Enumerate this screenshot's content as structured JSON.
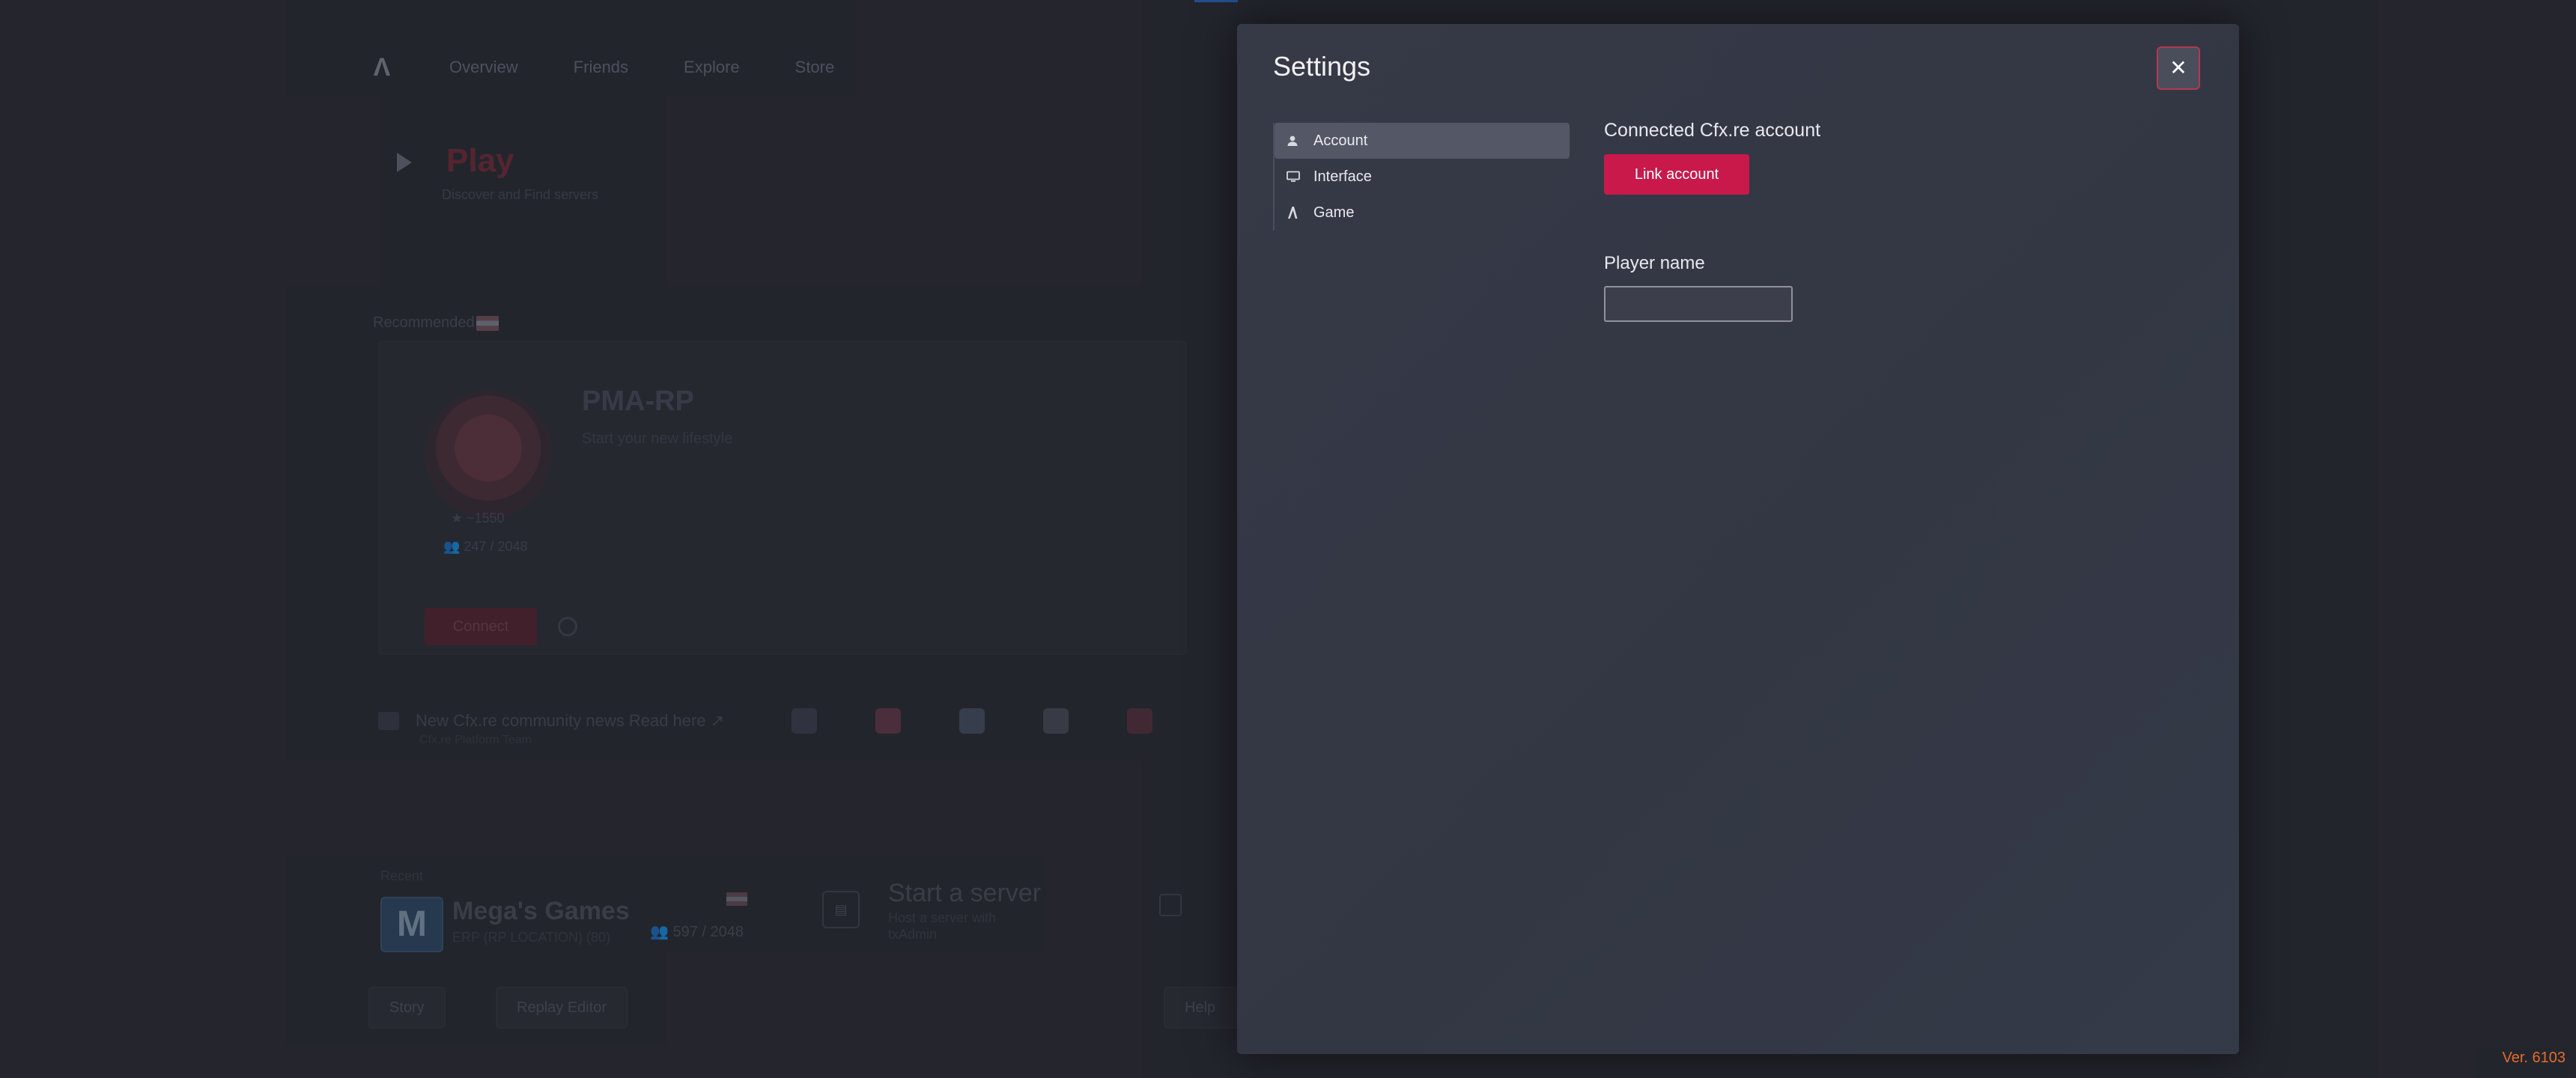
{
  "background": {
    "nav": [
      "Overview",
      "Friends",
      "Explore",
      "Store"
    ],
    "play_title": "Play",
    "play_subtitle": "Discover and Find servers",
    "recommended_label": "Recommended",
    "server": {
      "name": "PMA-RP",
      "description": "Start your new lifestyle",
      "stat1": "★ ~1550",
      "stat2": "👥 247 / 2048",
      "connect_label": "Connect"
    },
    "news_text": "New Cfx.re community news Read here ↗",
    "news_sub": "Cfx.re Platform Team",
    "recent_label": "Recent",
    "recent_server": {
      "logo": "M",
      "name": "Mega's Games",
      "subtitle": "ERP (RP LOCATION) (80)",
      "players": "👥 597 / 2048"
    },
    "start_server": {
      "title": "Start a server",
      "line1": "Host a server with",
      "line2": "txAdmin"
    },
    "bottom_buttons": [
      "Story",
      "Replay Editor",
      "Help"
    ],
    "chip_colors": [
      "#3f4253",
      "#6a3a4e",
      "#4a5368",
      "#4d4f5e",
      "#5b3342"
    ]
  },
  "modal": {
    "title": "Settings",
    "close_icon": "close-icon",
    "menu": [
      {
        "label": "Account",
        "icon": "user-icon",
        "active": true
      },
      {
        "label": "Interface",
        "icon": "monitor-icon",
        "active": false
      },
      {
        "label": "Game",
        "icon": "game-logo-icon",
        "active": false
      }
    ],
    "account": {
      "connected_label": "Connected Cfx.re account",
      "link_button": "Link account",
      "player_name_label": "Player name",
      "player_name_value": "",
      "player_name_placeholder": ""
    }
  },
  "version": "Ver. 6103",
  "colors": {
    "accent": "#c8194a",
    "close_border": "#b13a52",
    "version": "#e46c2b"
  }
}
